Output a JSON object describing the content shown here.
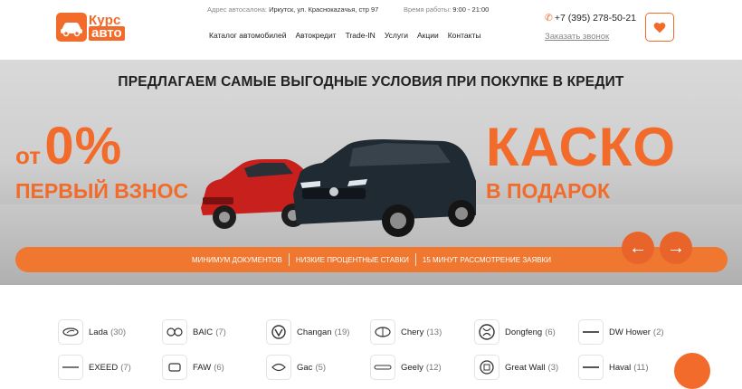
{
  "header": {
    "logo": {
      "line1": "Курс",
      "line2": "авто"
    },
    "address_label": "Адрес автосалона:",
    "address_value": "Иркутск, ул. Краснокazачья, стр 97",
    "hours_label": "Время работы:",
    "hours_value": "9:00 - 21:00",
    "nav": [
      "Каталог автомобилей",
      "Автокредит",
      "Trade-IN",
      "Услуги",
      "Акции",
      "Контакты"
    ],
    "phone": "+7 (395) 278-50-21",
    "callback": "Заказать звонок"
  },
  "hero": {
    "title": "ПРЕДЛАГАЕМ САМЫЕ ВЫГОДНЫЕ УСЛОВИЯ ПРИ ПОКУПКЕ В КРЕДИТ",
    "from": "от",
    "percent": "0%",
    "down_payment": "ПЕРВЫЙ ВЗНОС",
    "kasko": "КАСКО",
    "gift": "В ПОДАРОК",
    "features": [
      "МИНИМУМ ДОКУМЕНТОВ",
      "НИЗКИЕ ПРОЦЕНТНЫЕ СТАВКИ",
      "15 МИНУТ РАССМОТРЕНИЕ ЗАЯВКИ"
    ],
    "prev_arrow": "←",
    "next_arrow": "→"
  },
  "brands": [
    {
      "name": "Lada",
      "count": "(30)"
    },
    {
      "name": "BAIC",
      "count": "(7)"
    },
    {
      "name": "Changan",
      "count": "(19)"
    },
    {
      "name": "Chery",
      "count": "(13)"
    },
    {
      "name": "Dongfeng",
      "count": "(6)"
    },
    {
      "name": "DW Hower",
      "count": "(2)"
    },
    {
      "name": "EXEED",
      "count": "(7)"
    },
    {
      "name": "FAW",
      "count": "(6)"
    },
    {
      "name": "Gac",
      "count": "(5)"
    },
    {
      "name": "Geely",
      "count": "(12)"
    },
    {
      "name": "Great Wall",
      "count": "(3)"
    },
    {
      "name": "Haval",
      "count": "(11)"
    }
  ],
  "colors": {
    "accent": "#f26b2a",
    "bar": "#f0772f",
    "arrow": "#e8642a"
  },
  "icons": {
    "phone": "phone-icon",
    "favorites": "heart-icon"
  }
}
